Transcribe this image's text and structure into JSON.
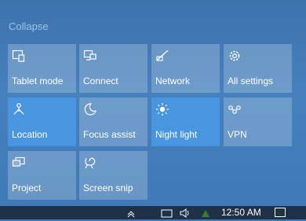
{
  "panel": {
    "collapse_label": "Collapse"
  },
  "tiles": [
    {
      "label": "Tablet mode",
      "icon": "tablet-mode-icon",
      "state": "off"
    },
    {
      "label": "Connect",
      "icon": "connect-icon",
      "state": "off"
    },
    {
      "label": "Network",
      "icon": "network-icon",
      "state": "off"
    },
    {
      "label": "All settings",
      "icon": "gear-icon",
      "state": "off"
    },
    {
      "label": "Location",
      "icon": "location-icon",
      "state": "on"
    },
    {
      "label": "Focus assist",
      "icon": "moon-icon",
      "state": "off"
    },
    {
      "label": "Night light",
      "icon": "sun-icon",
      "state": "on"
    },
    {
      "label": "VPN",
      "icon": "vpn-icon",
      "state": "off"
    },
    {
      "label": "Project",
      "icon": "project-icon",
      "state": "off"
    },
    {
      "label": "Screen snip",
      "icon": "screen-snip-icon",
      "state": "off"
    }
  ],
  "taskbar": {
    "clock": "12:50 AM"
  },
  "colors": {
    "panel_bg": "#4680bd",
    "tile_off": "rgba(255,255,255,0.22)",
    "tile_on": "#4a95e0",
    "taskbar_bg": "#1e3146"
  }
}
